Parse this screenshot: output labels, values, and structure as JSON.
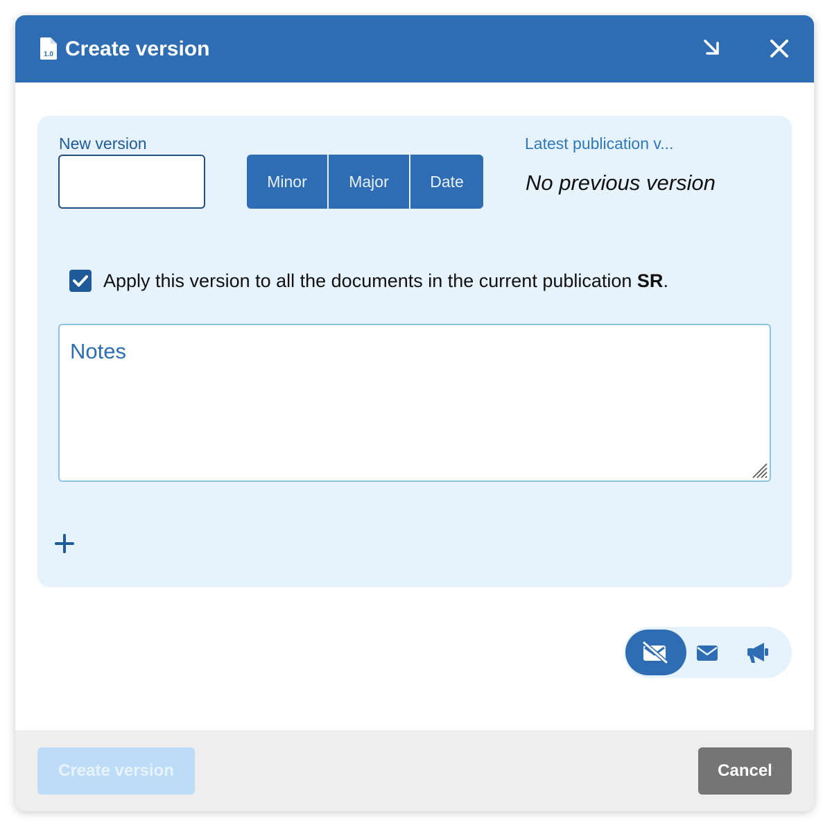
{
  "dialog": {
    "title": "Create version",
    "icon": "version-file-icon",
    "icon_badge": "1.0",
    "minimize_icon": "arrow-down-right-icon",
    "close_icon": "close-icon"
  },
  "form": {
    "new_version_label": "New version",
    "new_version_value": "",
    "version_buttons": {
      "minor": "Minor",
      "major": "Major",
      "date": "Date"
    },
    "latest_label": "Latest publication v...",
    "latest_value": "No previous version",
    "apply_checkbox": {
      "checked": true,
      "text_before": "Apply this version to all the documents in the current publication ",
      "publication": "SR",
      "text_after": "."
    },
    "notes_placeholder": "Notes",
    "add_icon": "plus-icon"
  },
  "notification": {
    "options": [
      "no-email-icon",
      "email-icon",
      "megaphone-icon"
    ],
    "selected": "no-email-icon"
  },
  "footer": {
    "create_label": "Create version",
    "create_disabled": true,
    "cancel_label": "Cancel"
  },
  "colors": {
    "primary": "#2e6db4",
    "panel": "#e6f2fc",
    "disabled": "#bcdcf7",
    "cancel": "#757575"
  }
}
